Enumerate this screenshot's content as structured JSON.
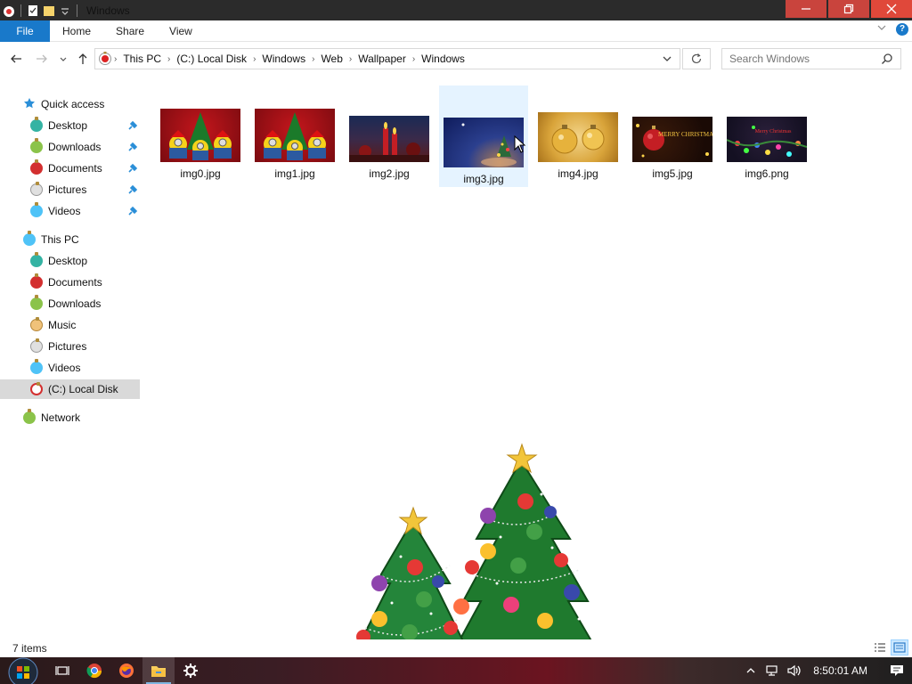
{
  "window": {
    "title": "Windows",
    "accent": "#1979ca"
  },
  "ribbon": {
    "tabs": [
      {
        "label": "File"
      },
      {
        "label": "Home"
      },
      {
        "label": "Share"
      },
      {
        "label": "View"
      }
    ]
  },
  "address": {
    "crumbs": [
      "This PC",
      "(C:) Local Disk",
      "Windows",
      "Web",
      "Wallpaper",
      "Windows"
    ]
  },
  "search": {
    "placeholder": "Search Windows"
  },
  "sidebar": {
    "quick_access": {
      "label": "Quick access",
      "items": [
        {
          "label": "Desktop",
          "icon": "desktop-ornament-icon"
        },
        {
          "label": "Downloads",
          "icon": "downloads-ornament-icon"
        },
        {
          "label": "Documents",
          "icon": "documents-ornament-icon"
        },
        {
          "label": "Pictures",
          "icon": "pictures-ornament-icon"
        },
        {
          "label": "Videos",
          "icon": "videos-ornament-icon"
        }
      ]
    },
    "this_pc": {
      "label": "This PC",
      "items": [
        {
          "label": "Desktop"
        },
        {
          "label": "Documents"
        },
        {
          "label": "Downloads"
        },
        {
          "label": "Music"
        },
        {
          "label": "Pictures"
        },
        {
          "label": "Videos"
        },
        {
          "label": "(C:) Local Disk",
          "selected": true
        }
      ]
    },
    "network": {
      "label": "Network"
    }
  },
  "files": [
    {
      "name": "img0.jpg",
      "theme": "minions"
    },
    {
      "name": "img1.jpg",
      "theme": "minions"
    },
    {
      "name": "img2.jpg",
      "theme": "candles"
    },
    {
      "name": "img3.jpg",
      "theme": "night",
      "selected": true
    },
    {
      "name": "img4.jpg",
      "theme": "gold"
    },
    {
      "name": "img5.jpg",
      "theme": "merry"
    },
    {
      "name": "img6.png",
      "theme": "lights"
    }
  ],
  "thumb_text": {
    "img5": "MERRY CHRISTMAS",
    "img6": "Merry Christmas"
  },
  "status": {
    "item_count": "7 items"
  },
  "taskbar": {
    "clock": "8:50:01 AM"
  }
}
